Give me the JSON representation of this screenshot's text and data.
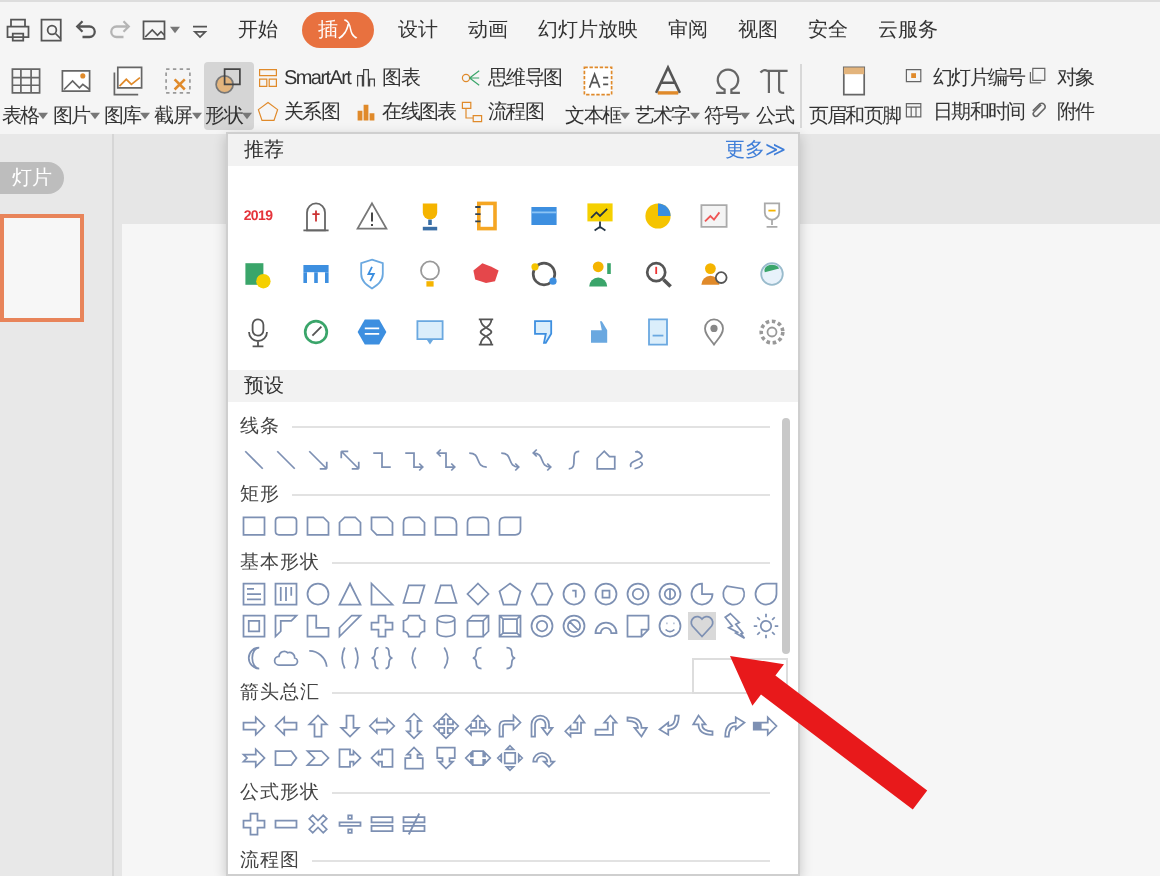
{
  "quick_access": [
    {
      "kind": "print",
      "disabled": false
    },
    {
      "kind": "preview",
      "disabled": false
    },
    {
      "kind": "undo",
      "disabled": false
    },
    {
      "kind": "redo",
      "disabled": true
    },
    {
      "kind": "image",
      "disabled": false
    },
    {
      "kind": "customize",
      "disabled": false
    }
  ],
  "tabs": [
    {
      "label": "开始",
      "selected": false
    },
    {
      "label": "插入",
      "selected": true
    },
    {
      "label": "设计",
      "selected": false
    },
    {
      "label": "动画",
      "selected": false
    },
    {
      "label": "幻灯片放映",
      "selected": false
    },
    {
      "label": "审阅",
      "selected": false
    },
    {
      "label": "视图",
      "selected": false
    },
    {
      "label": "安全",
      "selected": false
    },
    {
      "label": "云服务",
      "selected": false
    }
  ],
  "ribbon": [
    {
      "kind": "table",
      "label": "表格",
      "dropdown": true,
      "pressed": false
    },
    {
      "kind": "picture",
      "label": "图片",
      "dropdown": true,
      "pressed": false
    },
    {
      "kind": "gallery",
      "label": "图库",
      "dropdown": true,
      "pressed": false
    },
    {
      "kind": "screenshot",
      "label": "截屏",
      "dropdown": true,
      "pressed": false
    },
    {
      "kind": "shapes",
      "label": "形状",
      "dropdown": true,
      "pressed": true
    },
    {
      "kind": "stack",
      "items": [
        {
          "kind": "smartart",
          "label": "SmartArt"
        },
        {
          "kind": "relation",
          "label": "关系图"
        }
      ]
    },
    {
      "kind": "stack",
      "items": [
        {
          "kind": "chart",
          "label": "图表"
        },
        {
          "kind": "online-chart",
          "label": "在线图表"
        }
      ]
    },
    {
      "kind": "stack",
      "items": [
        {
          "kind": "mindmap",
          "label": "思维导图"
        },
        {
          "kind": "flowchart",
          "label": "流程图"
        }
      ]
    },
    {
      "kind": "textbox",
      "label": "文本框",
      "dropdown": true,
      "pressed": false
    },
    {
      "kind": "wordart",
      "label": "艺术字",
      "dropdown": true,
      "pressed": false
    },
    {
      "kind": "omega",
      "label": "符号",
      "dropdown": true,
      "pressed": false
    },
    {
      "kind": "pi",
      "label": "公式",
      "dropdown": false,
      "pressed": false
    },
    {
      "kind": "separator"
    },
    {
      "kind": "header-footer",
      "label": "页眉和页脚",
      "dropdown": false,
      "pressed": false
    },
    {
      "kind": "stack",
      "items": [
        {
          "kind": "slide-number",
          "label": "幻灯片编号"
        },
        {
          "kind": "calendar",
          "label": "日期和时间"
        }
      ]
    },
    {
      "kind": "stack",
      "items": [
        {
          "kind": "object",
          "label": "对象"
        },
        {
          "kind": "paperclip",
          "label": "附件"
        }
      ]
    }
  ],
  "slides_panel": {
    "tab_label": "灯片",
    "thumbnails": [
      {
        "selected": true
      }
    ]
  },
  "shapes_menu": {
    "recommended": {
      "title": "推荐",
      "more_link": "更多≫",
      "icons": [
        {
          "kind": "year-badge",
          "text": "2019"
        },
        {
          "kind": "tombstone"
        },
        {
          "kind": "warning"
        },
        {
          "kind": "trophy"
        },
        {
          "kind": "notebook"
        },
        {
          "kind": "window"
        },
        {
          "kind": "presentation"
        },
        {
          "kind": "pie-chart"
        },
        {
          "kind": "chart-card"
        },
        {
          "kind": "cup"
        },
        {
          "kind": "money-card"
        },
        {
          "kind": "shop"
        },
        {
          "kind": "shield"
        },
        {
          "kind": "bulb"
        },
        {
          "kind": "map"
        },
        {
          "kind": "cycle"
        },
        {
          "kind": "person-up"
        },
        {
          "kind": "magnifier"
        },
        {
          "kind": "people-search"
        },
        {
          "kind": "globe"
        },
        {
          "kind": "microphone"
        },
        {
          "kind": "leaf-cycle"
        },
        {
          "kind": "hexagon-list"
        },
        {
          "kind": "chat"
        },
        {
          "kind": "hourglass"
        },
        {
          "kind": "dislike"
        },
        {
          "kind": "like"
        },
        {
          "kind": "document"
        },
        {
          "kind": "pin"
        },
        {
          "kind": "gear"
        }
      ]
    },
    "presets": {
      "title": "预设",
      "categories": [
        {
          "label": "线条",
          "items": [
            {
              "kind": "line"
            },
            {
              "kind": "line"
            },
            {
              "kind": "line-arrow"
            },
            {
              "kind": "line-double-arrow"
            },
            {
              "kind": "elbow"
            },
            {
              "kind": "elbow-arrow"
            },
            {
              "kind": "elbow-double-arrow"
            },
            {
              "kind": "curve"
            },
            {
              "kind": "curve-arrow"
            },
            {
              "kind": "curve-double-arrow"
            },
            {
              "kind": "s-curve"
            },
            {
              "kind": "freeform"
            },
            {
              "kind": "scribble"
            }
          ]
        },
        {
          "label": "矩形",
          "items": [
            {
              "kind": "rect"
            },
            {
              "kind": "round-rect"
            },
            {
              "kind": "snip-rect"
            },
            {
              "kind": "snip2-rect"
            },
            {
              "kind": "snip-diag-rect"
            },
            {
              "kind": "round-snip-rect"
            },
            {
              "kind": "round1-rect"
            },
            {
              "kind": "round2-rect"
            },
            {
              "kind": "round-diag-rect"
            }
          ]
        },
        {
          "label": "基本形状",
          "items": [
            {
              "kind": "textbox",
              "hovered": false
            },
            {
              "kind": "vertical-textbox",
              "hovered": false
            },
            {
              "kind": "ellipse",
              "hovered": false
            },
            {
              "kind": "triangle",
              "hovered": false
            },
            {
              "kind": "right-triangle",
              "hovered": false
            },
            {
              "kind": "parallelogram",
              "hovered": false
            },
            {
              "kind": "trapezoid",
              "hovered": false
            },
            {
              "kind": "diamond",
              "hovered": false
            },
            {
              "kind": "pentagon",
              "hovered": false
            },
            {
              "kind": "hexagon",
              "hovered": false
            },
            {
              "kind": "heptagon",
              "hovered": false
            },
            {
              "kind": "octagon",
              "hovered": false
            },
            {
              "kind": "decagon",
              "hovered": false
            },
            {
              "kind": "dodecagon",
              "hovered": false
            },
            {
              "kind": "pie",
              "hovered": false
            },
            {
              "kind": "chord",
              "hovered": false
            },
            {
              "kind": "teardrop",
              "hovered": false
            },
            {
              "kind": "frame",
              "hovered": false
            },
            {
              "kind": "half-frame",
              "hovered": false
            },
            {
              "kind": "l-shape",
              "hovered": false
            },
            {
              "kind": "diagonal-stripe",
              "hovered": false
            },
            {
              "kind": "cross",
              "hovered": false
            },
            {
              "kind": "plaque",
              "hovered": false
            },
            {
              "kind": "can",
              "hovered": false
            },
            {
              "kind": "cube",
              "hovered": false
            },
            {
              "kind": "bevel",
              "hovered": false
            },
            {
              "kind": "donut",
              "hovered": false
            },
            {
              "kind": "no-symbol",
              "hovered": false
            },
            {
              "kind": "block-arc",
              "hovered": false
            },
            {
              "kind": "folded-corner",
              "hovered": false
            },
            {
              "kind": "smiley",
              "hovered": false
            },
            {
              "kind": "heart",
              "hovered": true
            },
            {
              "kind": "lightning",
              "hovered": false
            },
            {
              "kind": "sun",
              "hovered": false
            },
            {
              "kind": "moon",
              "hovered": false
            },
            {
              "kind": "cloud",
              "hovered": false
            },
            {
              "kind": "arc",
              "hovered": false
            },
            {
              "kind": "bracket-pair",
              "hovered": false
            },
            {
              "kind": "brace-pair",
              "hovered": false
            },
            {
              "kind": "left-bracket",
              "hovered": false
            },
            {
              "kind": "right-bracket",
              "hovered": false
            },
            {
              "kind": "left-brace",
              "hovered": false
            },
            {
              "kind": "right-brace",
              "hovered": false
            }
          ]
        },
        {
          "label": "箭头总汇",
          "items": [
            {
              "kind": "right-arrow"
            },
            {
              "kind": "left-arrow"
            },
            {
              "kind": "up-arrow"
            },
            {
              "kind": "down-arrow"
            },
            {
              "kind": "left-right-arrow"
            },
            {
              "kind": "up-down-arrow"
            },
            {
              "kind": "quad-arrow"
            },
            {
              "kind": "left-right-up-arrow"
            },
            {
              "kind": "bent-arrow"
            },
            {
              "kind": "u-turn-arrow"
            },
            {
              "kind": "left-up-arrow"
            },
            {
              "kind": "bent-up-arrow"
            },
            {
              "kind": "curved-right-arrow"
            },
            {
              "kind": "curved-left-arrow"
            },
            {
              "kind": "curved-up-arrow"
            },
            {
              "kind": "curved-down-arrow"
            },
            {
              "kind": "striped-arrow"
            },
            {
              "kind": "notched-arrow"
            },
            {
              "kind": "pentagon-arrow"
            },
            {
              "kind": "chevron"
            },
            {
              "kind": "right-callout"
            },
            {
              "kind": "left-callout"
            },
            {
              "kind": "up-callout"
            },
            {
              "kind": "down-callout"
            },
            {
              "kind": "left-right-callout"
            },
            {
              "kind": "quad-callout"
            },
            {
              "kind": "circular-arrow"
            }
          ]
        },
        {
          "label": "公式形状",
          "items": [
            {
              "kind": "plus"
            },
            {
              "kind": "minus"
            },
            {
              "kind": "multiply"
            },
            {
              "kind": "divide"
            },
            {
              "kind": "equal"
            },
            {
              "kind": "not-equal"
            }
          ]
        },
        {
          "label": "流程图"
        }
      ]
    },
    "hover_tooltip": {
      "visible": true
    }
  },
  "annotations": [
    {
      "kind": "arrow"
    }
  ]
}
